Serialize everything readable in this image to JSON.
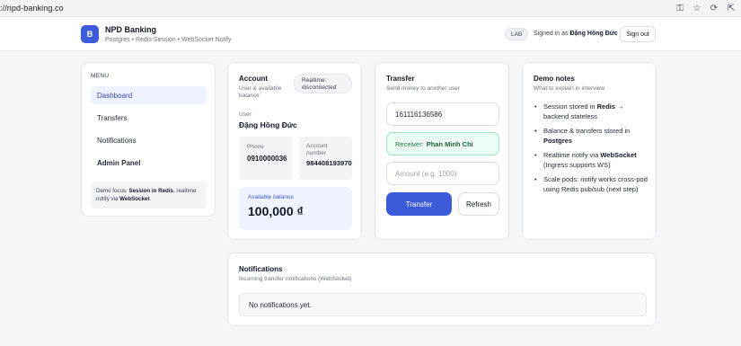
{
  "browser": {
    "url": "://npd-banking.co"
  },
  "header": {
    "logo_letter": "B",
    "title": "NPD Banking",
    "subtitle": "Postgres • Redis Session • WebSocket Notify",
    "env_badge": "LAB",
    "signed_in_prefix": "Signed in as",
    "user_name": "Đặng Hồng Đức",
    "signout_label": "Sign out"
  },
  "menu": {
    "heading": "MENU",
    "items": [
      {
        "label": "Dashboard",
        "active": true
      },
      {
        "label": "Transfers"
      },
      {
        "label": "Notifications"
      },
      {
        "label": "Admin Panel"
      }
    ],
    "note_prefix": "Demo focus:",
    "note_redis": "Session in Redis",
    "note_mid": ", realtime notify via",
    "note_ws": "WebSocket",
    "note_end": "."
  },
  "account": {
    "title": "Account",
    "subtitle": "User & available balance",
    "realtime_line1": "Realtime:",
    "realtime_line2": "disconnected",
    "user_label": "User",
    "user_name": "Đặng Hồng Đức",
    "phone_label": "Phone",
    "phone": "0910000036",
    "acct_label_1": "Account",
    "acct_label_2": "number",
    "acct_number": "984408193970",
    "balance_label": "Available balance",
    "balance": "100,000 ₫"
  },
  "transfer": {
    "title": "Transfer",
    "subtitle": "Send money to another user",
    "account_value": "161116136586",
    "receiver_label": "Receiver:",
    "receiver_name": "Phan Minh Chi",
    "amount_placeholder": "Amount (e.g. 1000)",
    "submit_label": "Transfer",
    "refresh_label": "Refresh"
  },
  "notes": {
    "title": "Demo notes",
    "subtitle": "What to explain in interview",
    "items": [
      {
        "pre": "Session stored in ",
        "bold": "Redis",
        "post": " → backend stateless"
      },
      {
        "pre": "Balance & transfers stored in ",
        "bold": "Postgres",
        "post": ""
      },
      {
        "pre": "Realtime notify via ",
        "bold": "WebSocket",
        "post": " (Ingress supports WS)"
      },
      {
        "pre": "Scale pods: notify works cross-pod using Redis pub/sub (next step)",
        "bold": "",
        "post": ""
      }
    ]
  },
  "notifications": {
    "title": "Notifications",
    "subtitle": "Incoming transfer notifications (WebSocket)",
    "empty_text": "No notifications yet."
  },
  "colors": {
    "primary": "#3b5bdb",
    "success_bg": "#ecfdf3",
    "success_text": "#1f7a46"
  }
}
